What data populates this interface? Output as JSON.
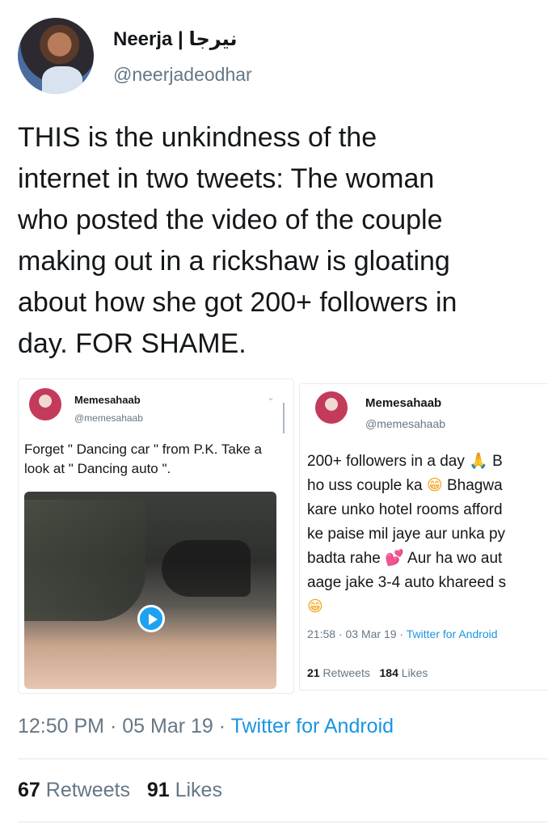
{
  "tweet": {
    "display_name": "Neerja | نیرجا",
    "handle": "@neerjadeodhar",
    "text": "THIS is the unkindness of the\ninternet in two tweets: The woman\nwho posted the video of the couple\nmaking out in a rickshaw is gloating\nabout how she got 200+ followers in\nday. FOR SHAME.",
    "time": "12:50 PM",
    "date": "05 Mar 19",
    "source": "Twitter for Android",
    "retweets": "67",
    "retweets_label": "Retweets",
    "likes": "91",
    "likes_label": "Likes"
  },
  "embedded_left": {
    "name": "Memesahaab",
    "handle": "@memesahaab",
    "text": "Forget \" Dancing car \" from P.K. Take a look at \" Dancing auto \"."
  },
  "embedded_right": {
    "name": "Memesahaab",
    "handle": "@memesahaab",
    "line1": "200+ followers in a day",
    "line1_tail": "B",
    "line2a": "ho uss couple ka",
    "line2b": "Bhagwa",
    "line3": "kare unko hotel rooms afford",
    "line4": "ke paise mil jaye aur unka py",
    "line5a": "badta rahe",
    "line5b": "Aur ha wo aut",
    "line6": "aage jake 3-4 auto khareed s",
    "time": "21:58",
    "date": "03 Mar 19",
    "source": "Twitter for Android",
    "retweets": "21",
    "retweets_label": "Retweets",
    "likes": "184",
    "likes_label": "Likes"
  },
  "icons": {
    "folded_hands": "folded-hands-emoji",
    "grin": "grinning-emoji",
    "hearts": "two-hearts-emoji",
    "play": "play-icon"
  }
}
